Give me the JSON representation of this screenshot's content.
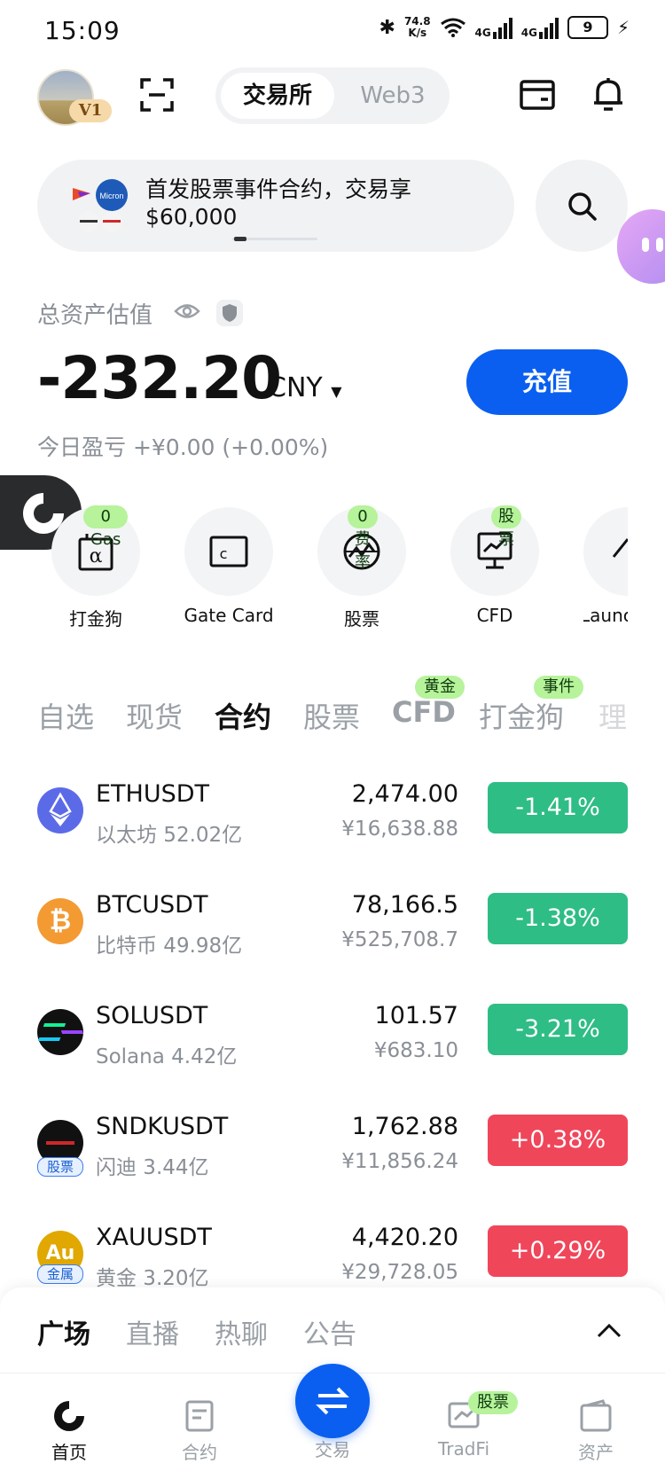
{
  "status": {
    "time": "15:09",
    "net_speed": "74.8",
    "net_unit": "K/s",
    "sig1": "4G",
    "sig2": "4G",
    "battery": "9"
  },
  "header": {
    "vip": "V1",
    "tab_exchange": "交易所",
    "tab_web3": "Web3"
  },
  "banner": {
    "text": "首发股票事件合约，交易享 $60,000",
    "logo_text": "Micron"
  },
  "assets": {
    "label": "总资产估值",
    "value": "-232.20",
    "currency": "CNY",
    "deposit": "充值",
    "pnl": "今日盈亏 +¥0.00 (+0.00%)"
  },
  "shortcuts": [
    {
      "label": "打金狗",
      "tag": "0 Gas",
      "glyph": "α"
    },
    {
      "label": "Gate Card",
      "tag": "",
      "glyph": "c"
    },
    {
      "label": "股票",
      "tag": "0 费率",
      "glyph": ""
    },
    {
      "label": "CFD",
      "tag": "股票",
      "glyph": ""
    },
    {
      "label": "Launc",
      "tag": "",
      "glyph": ""
    }
  ],
  "tabs": [
    {
      "label": "自选",
      "tag": ""
    },
    {
      "label": "现货",
      "tag": ""
    },
    {
      "label": "合约",
      "tag": ""
    },
    {
      "label": "股票",
      "tag": ""
    },
    {
      "label": "CFD",
      "tag": "黄金"
    },
    {
      "label": "打金狗",
      "tag": "事件"
    },
    {
      "label": "理",
      "tag": ""
    }
  ],
  "markets": [
    {
      "symbol": "ETHUSDT",
      "sub": "以太坊 52.02亿",
      "price": "2,474.00",
      "cny": "¥16,638.88",
      "change": "-1.41%",
      "tag": "",
      "coin_color": "#5b6be8"
    },
    {
      "symbol": "BTCUSDT",
      "sub": "比特币 49.98亿",
      "price": "78,166.5",
      "cny": "¥525,708.7",
      "change": "-1.38%",
      "tag": "",
      "coin_color": "#f39a33"
    },
    {
      "symbol": "SOLUSDT",
      "sub": "Solana 4.42亿",
      "price": "101.57",
      "cny": "¥683.10",
      "change": "-3.21%",
      "tag": "",
      "coin_color": "#111111"
    },
    {
      "symbol": "SNDKUSDT",
      "sub": "闪迪 3.44亿",
      "price": "1,762.88",
      "cny": "¥11,856.24",
      "change": "+0.38%",
      "tag": "股票",
      "coin_color": "#111111"
    },
    {
      "symbol": "XAUUSDT",
      "sub": "黄金 3.20亿",
      "price": "4,420.20",
      "cny": "¥29,728.05",
      "change": "+0.29%",
      "tag": "金属",
      "coin_color": "#e0a800",
      "coin_text": "Au"
    }
  ],
  "feed_tabs": [
    "广场",
    "直播",
    "热聊",
    "公告"
  ],
  "nav": [
    {
      "label": "首页"
    },
    {
      "label": "合约"
    },
    {
      "label": "交易"
    },
    {
      "label": "TradFi",
      "tag": "股票"
    },
    {
      "label": "资产"
    }
  ],
  "colors": {
    "accent": "#0a5ff0",
    "up": "#f0465a",
    "down": "#2ebd85",
    "tag_green": "#b6f39a"
  }
}
